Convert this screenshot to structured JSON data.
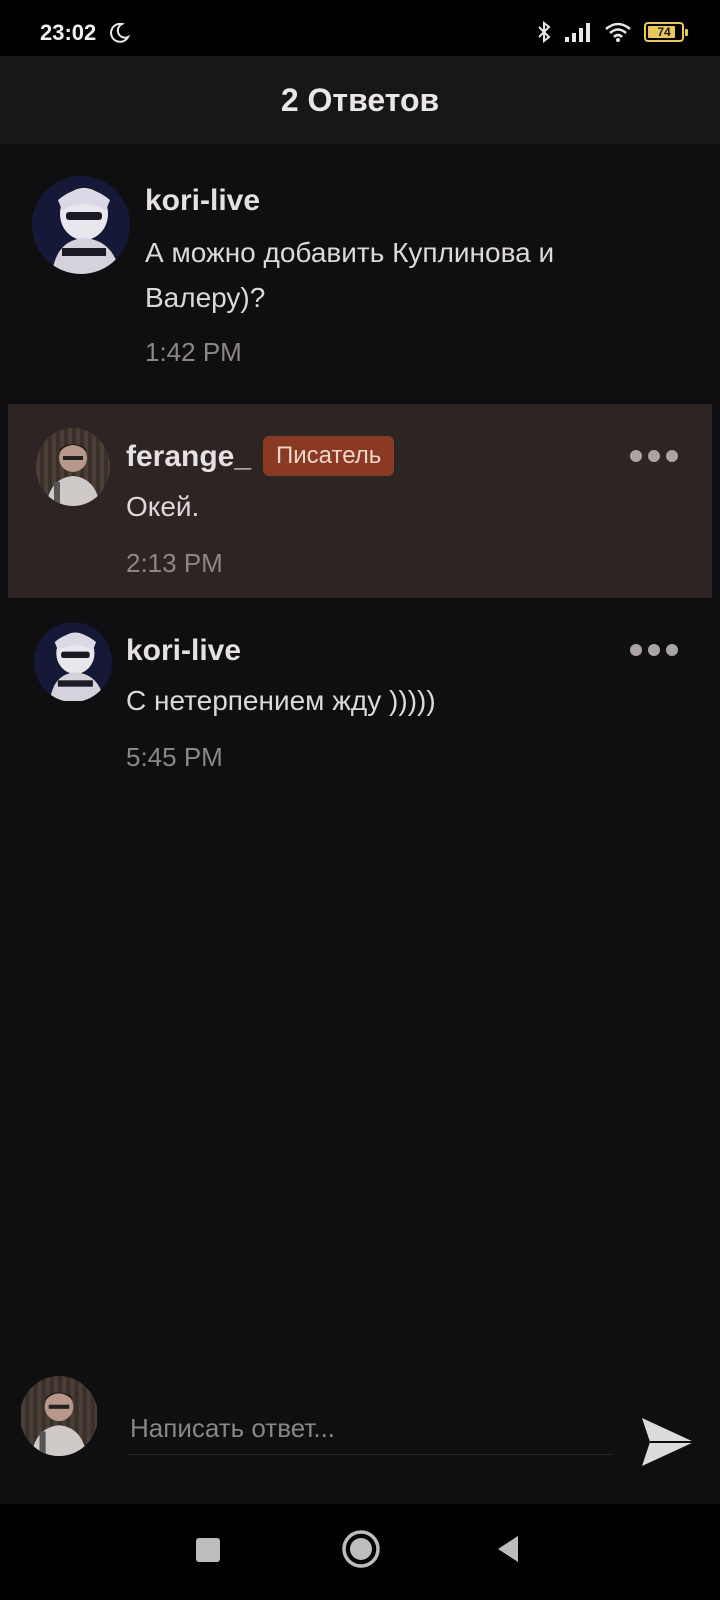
{
  "status_bar": {
    "time": "23:02",
    "battery_level": "74",
    "icons": [
      "moon-icon",
      "bluetooth-icon",
      "signal-icon",
      "wifi-icon",
      "battery-icon"
    ]
  },
  "header": {
    "title": "2 Ответов"
  },
  "comments": [
    {
      "username": "kori-live",
      "message": "А можно добавить Куплинова и Валеру)?",
      "time": "1:42 PM"
    },
    {
      "username": "ferange_",
      "badge": "Писатель",
      "message": "Окей.",
      "time": "2:13 PM"
    },
    {
      "username": "kori-live",
      "message": "С нетерпением жду )))))",
      "time": "5:45 PM"
    }
  ],
  "composer": {
    "placeholder": "Написать ответ..."
  },
  "colors": {
    "background": "#0f0e10",
    "header": "#171618",
    "highlight": "#2f2424",
    "badge": "#8a3a22"
  }
}
